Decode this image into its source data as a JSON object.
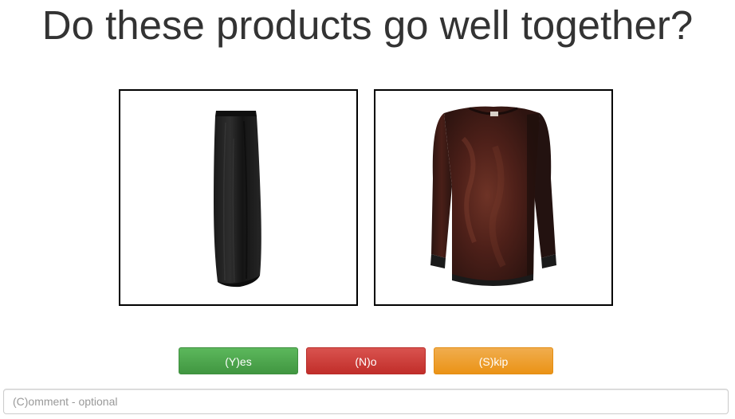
{
  "question": "Do these products go well together?",
  "products": [
    {
      "image": "black-maxi-skirt-image"
    },
    {
      "image": "burgundy-velvet-blouse-image"
    }
  ],
  "buttons": {
    "yes_label": "(Y)es",
    "no_label": "(N)o",
    "skip_label": "(S)kip"
  },
  "colors": {
    "yes": "#5cb85c",
    "no": "#d9534f",
    "skip": "#f0ad4e"
  },
  "comment": {
    "placeholder": "(C)omment - optional",
    "value": ""
  }
}
